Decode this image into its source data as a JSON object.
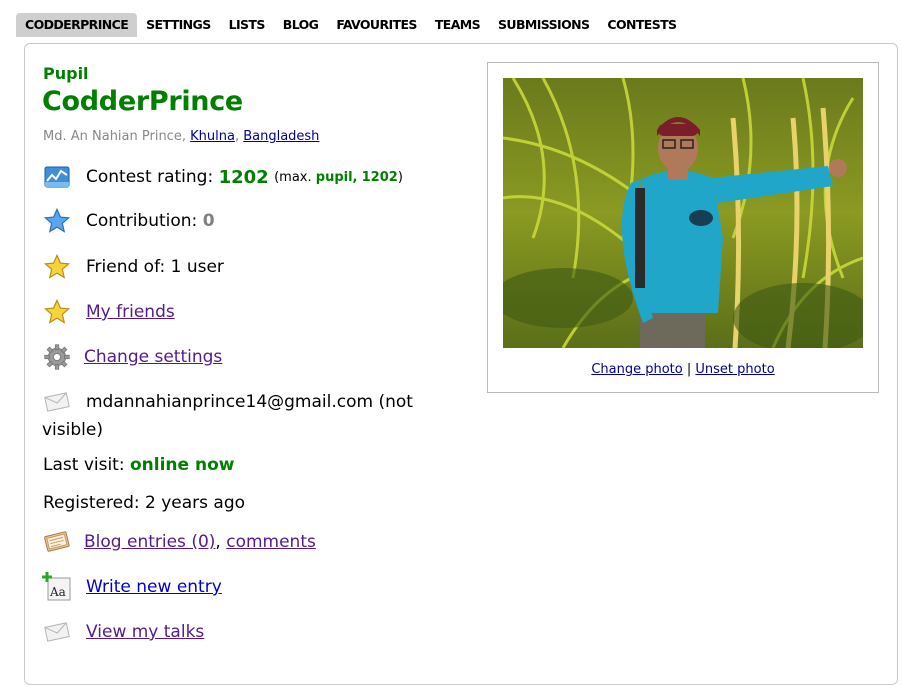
{
  "nav": {
    "items": [
      "CODDERPRINCE",
      "SETTINGS",
      "LISTS",
      "BLOG",
      "FAVOURITES",
      "TEAMS",
      "SUBMISSIONS",
      "CONTESTS"
    ]
  },
  "profile": {
    "rank": "Pupil",
    "handle": "CodderPrince",
    "full_name": "Md. An Nahian Prince",
    "city": "Khulna",
    "country": "Bangladesh",
    "rating_label": "Contest rating:",
    "rating": "1202",
    "max_prefix": "(max.",
    "max_rank": "pupil,",
    "max_rating": "1202",
    "max_suffix": ")",
    "contribution_label": "Contribution:",
    "contribution": "0",
    "friend_of": "Friend of: 1 user",
    "my_friends": "My friends",
    "change_settings": "Change settings",
    "email": "mdannahianprince14@gmail.com (not visible)",
    "last_visit_label": "Last visit:",
    "last_visit": "online now",
    "registered": "Registered: 2 years ago",
    "blog_entries": "Blog entries (0)",
    "comments": "comments",
    "write_new_entry": "Write new entry",
    "view_my_talks": "View my talks"
  },
  "photo": {
    "change": "Change photo",
    "separator": "|",
    "unset": "Unset photo"
  },
  "colors": {
    "rank_green": "#008000",
    "nav_active_bg": "#cfcfcf",
    "link_visited": "#551a8b",
    "link_blue": "#0000cc"
  }
}
